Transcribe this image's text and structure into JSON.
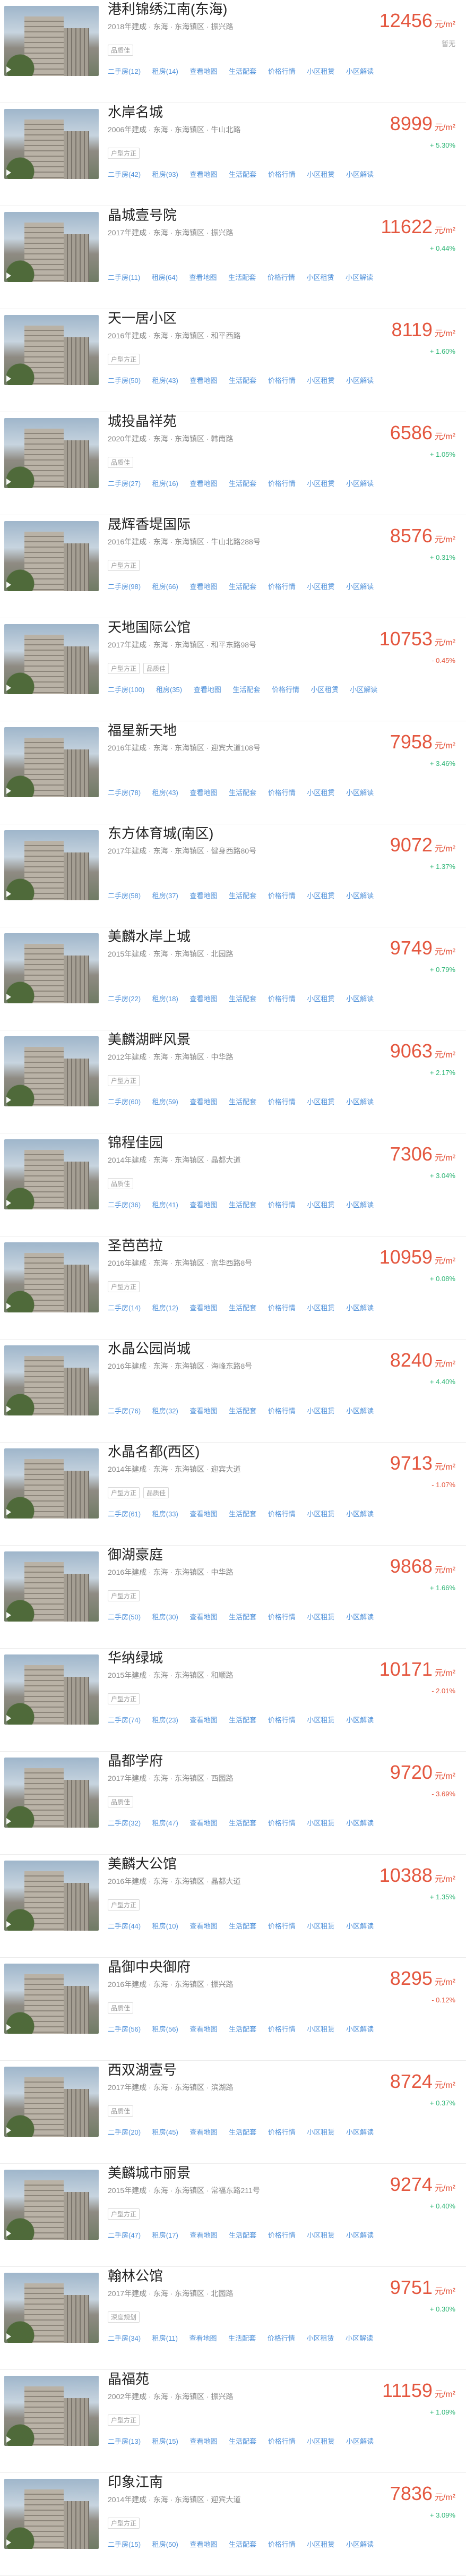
{
  "unit": "元/m²",
  "link_labels": [
    "二手房",
    "租房",
    "查看地图",
    "生活配套",
    "价格行情",
    "小区租赁",
    "小区解读"
  ],
  "items": [
    {
      "name": "港利锦绣江南(东海)",
      "meta": "2018年建成 · 东海 · 东海镇区 · 振兴路",
      "tags": [
        "品质佳"
      ],
      "counts": [
        "二手房(12)",
        "租房(14)"
      ],
      "price": "12456",
      "change": "暂无",
      "change_dir": "none"
    },
    {
      "name": "水岸名城",
      "meta": "2006年建成 · 东海 · 东海镇区 · 牛山北路",
      "tags": [
        "户型方正"
      ],
      "counts": [
        "二手房(42)",
        "租房(93)"
      ],
      "price": "8999",
      "change": "+ 5.30%",
      "change_dir": "up"
    },
    {
      "name": "晶城壹号院",
      "meta": "2017年建成 · 东海 · 东海镇区 · 振兴路",
      "tags": [],
      "counts": [
        "二手房(11)",
        "租房(64)"
      ],
      "price": "11622",
      "change": "+ 0.44%",
      "change_dir": "up"
    },
    {
      "name": "天一居小区",
      "meta": "2016年建成 · 东海 · 东海镇区 · 和平西路",
      "tags": [
        "户型方正"
      ],
      "counts": [
        "二手房(50)",
        "租房(43)"
      ],
      "price": "8119",
      "change": "+ 1.60%",
      "change_dir": "up"
    },
    {
      "name": "城投晶祥苑",
      "meta": "2020年建成 · 东海 · 东海镇区 · 韩南路",
      "tags": [
        "品质佳"
      ],
      "counts": [
        "二手房(27)",
        "租房(16)"
      ],
      "price": "6586",
      "change": "+ 1.05%",
      "change_dir": "up"
    },
    {
      "name": "晟辉香堤国际",
      "meta": "2016年建成 · 东海 · 东海镇区 · 牛山北路288号",
      "tags": [
        "户型方正"
      ],
      "counts": [
        "二手房(98)",
        "租房(66)"
      ],
      "price": "8576",
      "change": "+ 0.31%",
      "change_dir": "up"
    },
    {
      "name": "天地国际公馆",
      "meta": "2017年建成 · 东海 · 东海镇区 · 和平东路98号",
      "tags": [
        "户型方正",
        "品质佳"
      ],
      "counts": [
        "二手房(100)",
        "租房(35)"
      ],
      "price": "10753",
      "change": "- 0.45%",
      "change_dir": "down"
    },
    {
      "name": "福星新天地",
      "meta": "2016年建成 · 东海 · 东海镇区 · 迎宾大道108号",
      "tags": [],
      "counts": [
        "二手房(78)",
        "租房(43)"
      ],
      "price": "7958",
      "change": "+ 3.46%",
      "change_dir": "up"
    },
    {
      "name": "东方体育城(南区)",
      "meta": "2017年建成 · 东海 · 东海镇区 · 健身西路80号",
      "tags": [],
      "counts": [
        "二手房(58)",
        "租房(37)"
      ],
      "price": "9072",
      "change": "+ 1.37%",
      "change_dir": "up"
    },
    {
      "name": "美麟水岸上城",
      "meta": "2015年建成 · 东海 · 东海镇区 · 北园路",
      "tags": [],
      "counts": [
        "二手房(22)",
        "租房(18)"
      ],
      "price": "9749",
      "change": "+ 0.79%",
      "change_dir": "up"
    },
    {
      "name": "美麟湖畔风景",
      "meta": "2012年建成 · 东海 · 东海镇区 · 中华路",
      "tags": [
        "户型方正"
      ],
      "counts": [
        "二手房(60)",
        "租房(59)"
      ],
      "price": "9063",
      "change": "+ 2.17%",
      "change_dir": "up"
    },
    {
      "name": "锦程佳园",
      "meta": "2014年建成 · 东海 · 东海镇区 · 晶都大道",
      "tags": [
        "品质佳"
      ],
      "counts": [
        "二手房(36)",
        "租房(41)"
      ],
      "price": "7306",
      "change": "+ 3.04%",
      "change_dir": "up"
    },
    {
      "name": "圣芭芭拉",
      "meta": "2016年建成 · 东海 · 东海镇区 · 富华西路8号",
      "tags": [
        "户型方正"
      ],
      "counts": [
        "二手房(14)",
        "租房(12)"
      ],
      "price": "10959",
      "change": "+ 0.08%",
      "change_dir": "up"
    },
    {
      "name": "水晶公园尚城",
      "meta": "2016年建成 · 东海 · 东海镇区 · 海峰东路8号",
      "tags": [],
      "counts": [
        "二手房(76)",
        "租房(32)"
      ],
      "price": "8240",
      "change": "+ 4.40%",
      "change_dir": "up"
    },
    {
      "name": "水晶名都(西区)",
      "meta": "2014年建成 · 东海 · 东海镇区 · 迎宾大道",
      "tags": [
        "户型方正",
        "品质佳"
      ],
      "counts": [
        "二手房(61)",
        "租房(33)"
      ],
      "price": "9713",
      "change": "- 1.07%",
      "change_dir": "down"
    },
    {
      "name": "御湖豪庭",
      "meta": "2016年建成 · 东海 · 东海镇区 · 中华路",
      "tags": [
        "户型方正"
      ],
      "counts": [
        "二手房(50)",
        "租房(30)"
      ],
      "price": "9868",
      "change": "+ 1.66%",
      "change_dir": "up"
    },
    {
      "name": "华纳绿城",
      "meta": "2015年建成 · 东海 · 东海镇区 · 和顺路",
      "tags": [
        "户型方正"
      ],
      "counts": [
        "二手房(74)",
        "租房(23)"
      ],
      "price": "10171",
      "change": "- 2.01%",
      "change_dir": "down"
    },
    {
      "name": "晶都学府",
      "meta": "2017年建成 · 东海 · 东海镇区 · 西园路",
      "tags": [
        "品质佳"
      ],
      "counts": [
        "二手房(32)",
        "租房(47)"
      ],
      "price": "9720",
      "change": "- 3.69%",
      "change_dir": "down"
    },
    {
      "name": "美麟大公馆",
      "meta": "2016年建成 · 东海 · 东海镇区 · 晶都大道",
      "tags": [
        "户型方正"
      ],
      "counts": [
        "二手房(44)",
        "租房(10)"
      ],
      "price": "10388",
      "change": "+ 1.35%",
      "change_dir": "up"
    },
    {
      "name": "晶御中央御府",
      "meta": "2016年建成 · 东海 · 东海镇区 · 振兴路",
      "tags": [
        "品质佳"
      ],
      "counts": [
        "二手房(56)",
        "租房(56)"
      ],
      "price": "8295",
      "change": "- 0.12%",
      "change_dir": "down"
    },
    {
      "name": "西双湖壹号",
      "meta": "2017年建成 · 东海 · 东海镇区 · 滨湖路",
      "tags": [
        "品质佳"
      ],
      "counts": [
        "二手房(20)",
        "租房(45)"
      ],
      "price": "8724",
      "change": "+ 0.37%",
      "change_dir": "up"
    },
    {
      "name": "美麟城市丽景",
      "meta": "2015年建成 · 东海 · 东海镇区 · 常福东路211号",
      "tags": [
        "户型方正"
      ],
      "counts": [
        "二手房(47)",
        "租房(17)"
      ],
      "price": "9274",
      "change": "+ 0.40%",
      "change_dir": "up"
    },
    {
      "name": "翰林公馆",
      "meta": "2017年建成 · 东海 · 东海镇区 · 北园路",
      "tags": [
        "深度规划"
      ],
      "counts": [
        "二手房(34)",
        "租房(11)"
      ],
      "price": "9751",
      "change": "+ 0.30%",
      "change_dir": "up"
    },
    {
      "name": "晶福苑",
      "meta": "2002年建成 · 东海 · 东海镇区 · 振兴路",
      "tags": [
        "户型方正"
      ],
      "counts": [
        "二手房(13)",
        "租房(15)"
      ],
      "price": "11159",
      "change": "+ 1.09%",
      "change_dir": "up"
    },
    {
      "name": "印象江南",
      "meta": "2014年建成 · 东海 · 东海镇区 · 迎宾大道",
      "tags": [
        "户型方正"
      ],
      "counts": [
        "二手房(15)",
        "租房(50)"
      ],
      "price": "7836",
      "change": "+ 3.09%",
      "change_dir": "up"
    }
  ]
}
